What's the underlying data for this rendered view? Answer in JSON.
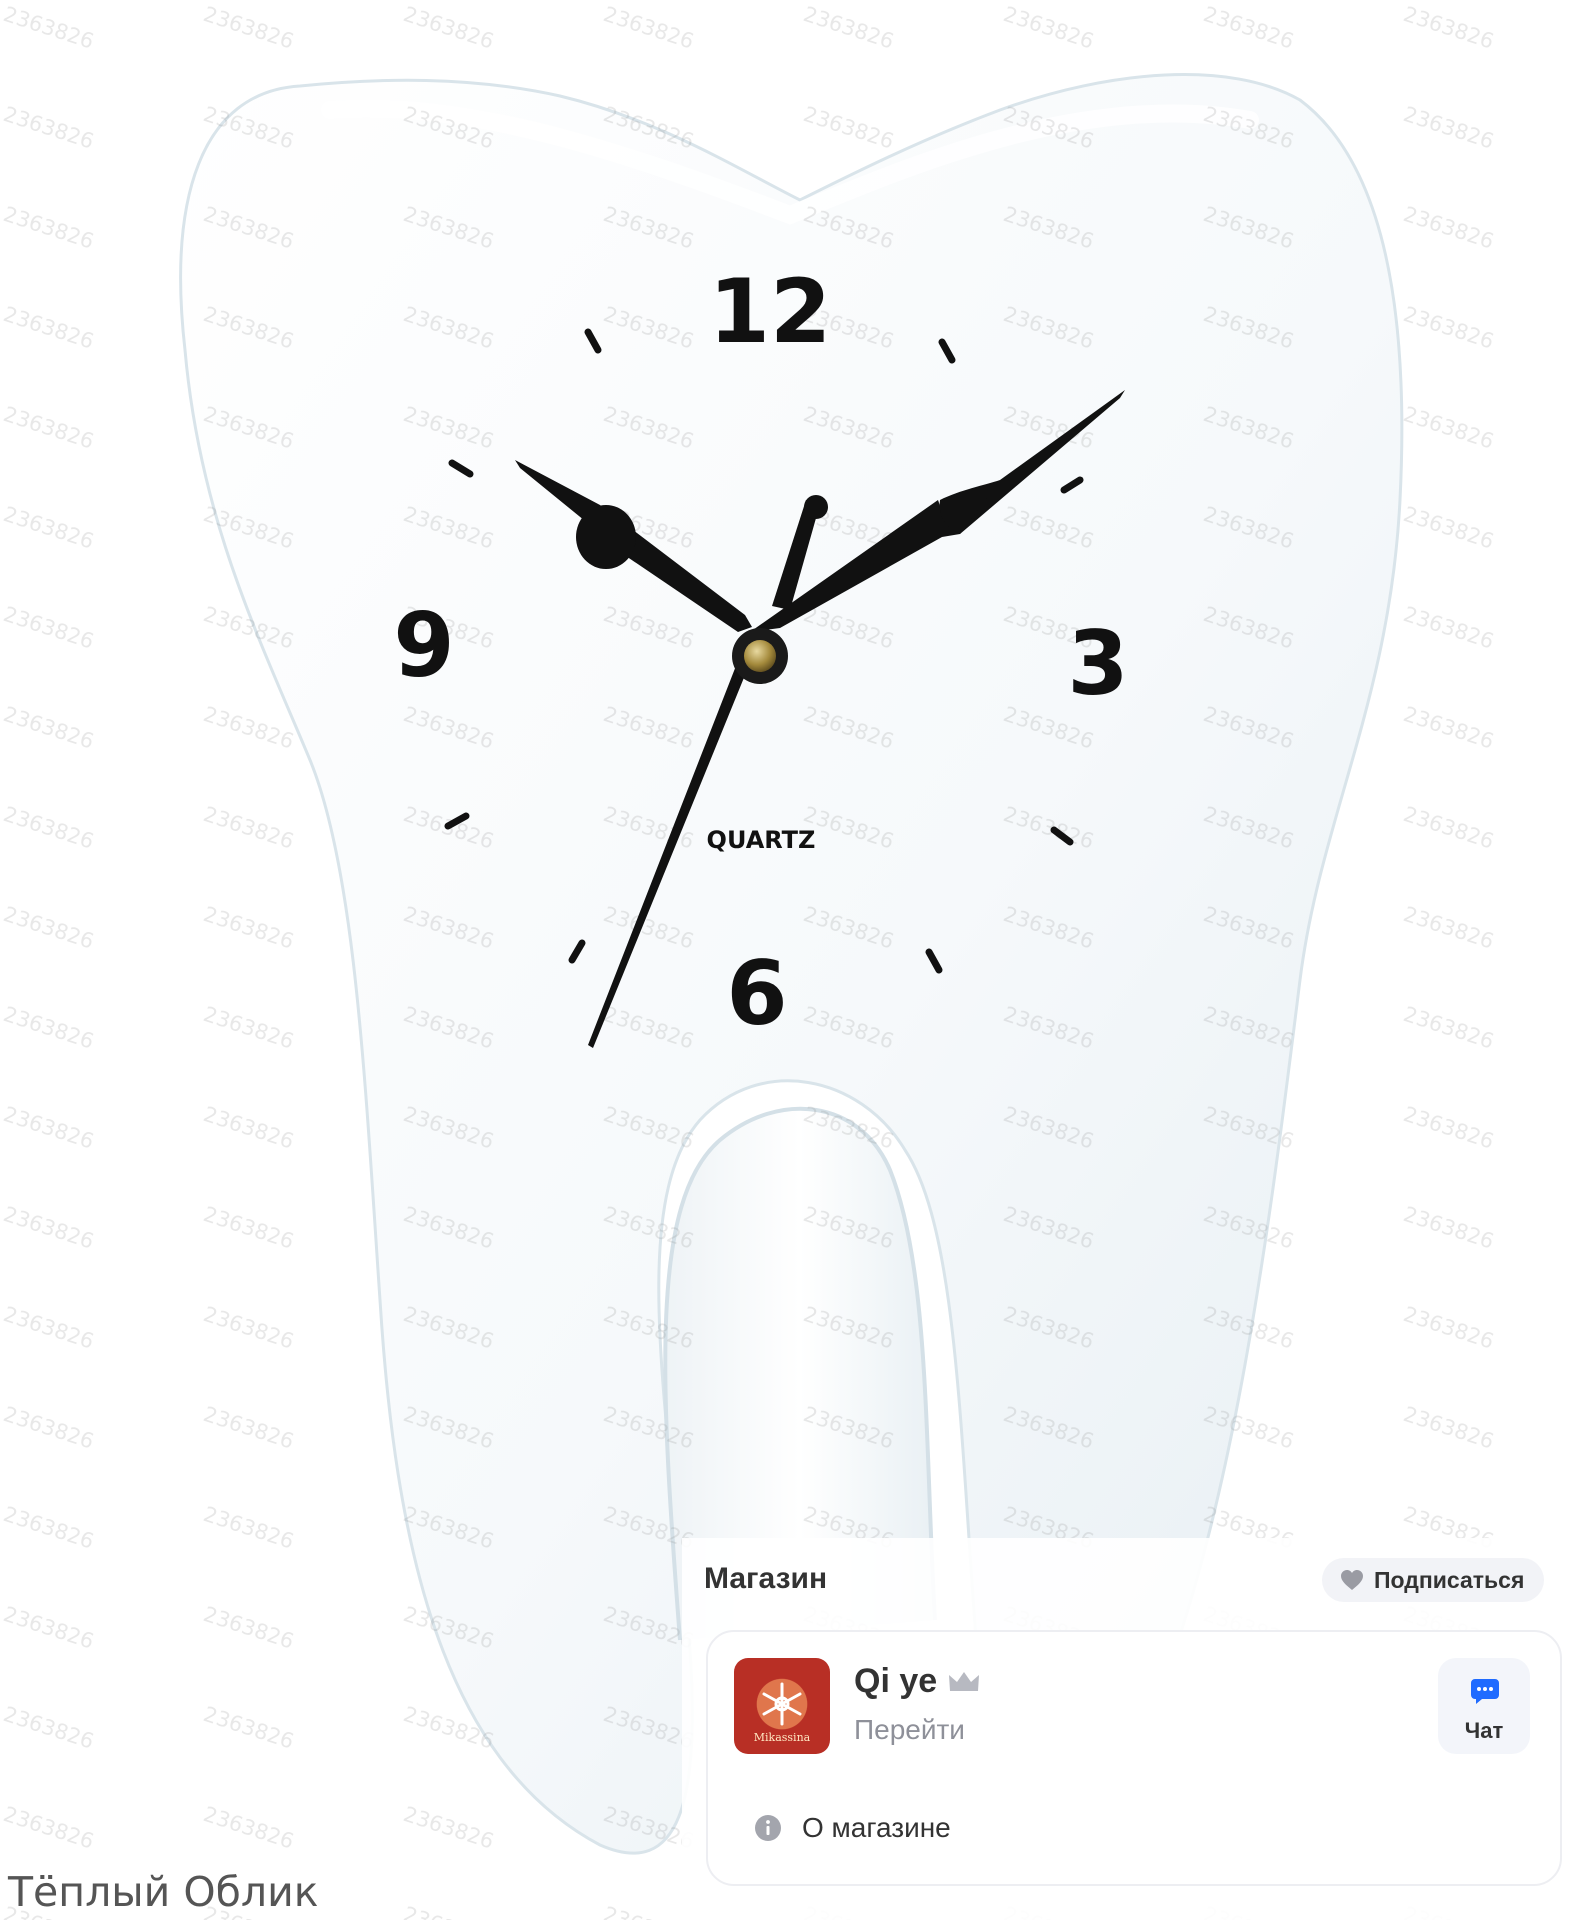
{
  "product_image": {
    "clock": {
      "numerals": {
        "twelve": "12",
        "three": "3",
        "six": "6",
        "nine": "9"
      },
      "brand_label": "QUARTZ"
    },
    "watermark": "2363826"
  },
  "store": {
    "section_title": "Магазин",
    "subscribe_label": "Подписаться",
    "card": {
      "logo_text": "Mikassina",
      "name": "Qi ye",
      "goto_label": "Перейти",
      "chat_label": "Чат",
      "about_label": "О магазине"
    }
  },
  "caption": "Тёплый Облик",
  "colors": {
    "tooth": "#f7fafc",
    "hands": "#111111",
    "accent_chat": "#1f6bff",
    "heart": "#9a9ba3"
  },
  "icons": [
    "heart-icon",
    "crown-icon",
    "chat-bubble-icon",
    "info-icon"
  ]
}
